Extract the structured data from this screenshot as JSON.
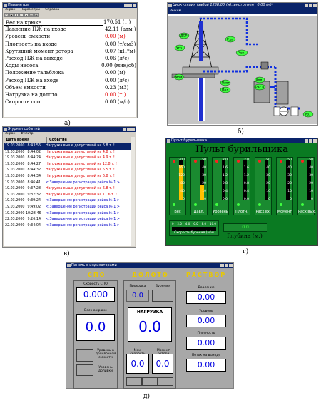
{
  "window_a": {
    "title": "Параметры",
    "menu": [
      "Экран",
      "Параметры",
      "Справка"
    ],
    "toolbar": [
      "▢",
      "▣",
      "A",
      "C",
      "S",
      "▤",
      "▦"
    ],
    "rows": [
      {
        "name": "Вес на крюке",
        "value": "170.51 (т.)",
        "red": false
      },
      {
        "name": "Давление ПЖ на входе",
        "value": "42.11 (атм.)",
        "red": false
      },
      {
        "name": "Уровень емкости",
        "value": "0.00 (м)",
        "red": true
      },
      {
        "name": "Плотность на входе",
        "value": "0.00 (т/см3)",
        "red": false
      },
      {
        "name": "Крутящий момент ротора",
        "value": "0.07 (кН*м)",
        "red": false
      },
      {
        "name": "Расход ПЖ на выходе",
        "value": "0.06 (л/с)",
        "red": false
      },
      {
        "name": "Ходы насоса",
        "value": "0.00 (мин/об)",
        "red": false
      },
      {
        "name": "Положение тальблока",
        "value": "0.00 (м)",
        "red": false
      },
      {
        "name": "Расход ПЖ на входе",
        "value": "0.00 (л/с)",
        "red": false
      },
      {
        "name": "Объем емкости",
        "value": "0.23 (м3)",
        "red": false
      },
      {
        "name": "Нагрузка на долото",
        "value": "0.00 (т.)",
        "red": true
      },
      {
        "name": "Скорость спо",
        "value": "0.00 (м/с)",
        "red": false
      }
    ],
    "caption": "а)"
  },
  "window_b": {
    "title": "Циркуляция (забой 1238.00 (м), инструмент 0.00 (м))",
    "menu": [
      "Режим"
    ],
    "labels": {
      "dcp": "ДСР",
      "ugr": "Угр.",
      "rvh": "Р.вх.",
      "mom": "Мом.",
      "pvh": "Р.вх.",
      "plot_in": "Плот.",
      "hod": "Ход.",
      "poll": "Пол.",
      "rasn": "Рас.н.",
      "ur": "Ур."
    },
    "caption": "б)"
  },
  "window_v": {
    "title": "Журнал событий",
    "menu": [
      "Экран",
      "Фильтр"
    ],
    "headers": [
      "Дата время",
      "Событие"
    ],
    "rows": [
      {
        "date": "19.03.2000",
        "time": "8:43:56",
        "text": "Нагрузка выше допустимой на 6.8 т. !",
        "kind": "warn"
      },
      {
        "date": "19.03.2000",
        "time": "8:44:02",
        "text": "Нагрузка выше допустимой на 4.8 т. !",
        "kind": "warn"
      },
      {
        "date": "19.03.2000",
        "time": "8:44:24",
        "text": "Нагрузка выше допустимой на 4.9 т. !",
        "kind": "warn"
      },
      {
        "date": "19.03.2000",
        "time": "8:44:27",
        "text": "Нагрузка выше допустимой на 12.8 т. !",
        "kind": "warn"
      },
      {
        "date": "19.03.2000",
        "time": "8:44:32",
        "text": "Нагрузка выше допустимой на 5.5 т. !",
        "kind": "warn"
      },
      {
        "date": "19.03.2000",
        "time": "8:44:34",
        "text": "Нагрузка выше допустимой на 6.8 т. !",
        "kind": "warn"
      },
      {
        "date": "19.03.2000",
        "time": "8:46:41",
        "text": "< Завершение регистрации рейса № 1 >",
        "kind": "info"
      },
      {
        "date": "19.03.2000",
        "time": "9:37:28",
        "text": "Нагрузка выше допустимой на 6.8 т. !",
        "kind": "warn"
      },
      {
        "date": "19.03.2000",
        "time": "9:37:32",
        "text": "Нагрузка выше допустимой на 11.6 т. !",
        "kind": "warn"
      },
      {
        "date": "19.03.2000",
        "time": "9:39:24",
        "text": "< Завершение регистрации рейса № 1 >",
        "kind": "info"
      },
      {
        "date": "19.03.2000",
        "time": "9:49:02",
        "text": "< Завершение регистрации рейса № 1 >",
        "kind": "info"
      },
      {
        "date": "19.03.2000",
        "time": "10:28:46",
        "text": "< Завершение регистрации рейса № 1 >",
        "kind": "info"
      },
      {
        "date": "22.03.2000",
        "time": "9:26:14",
        "text": "< Завершение регистрации рейса № 1 >",
        "kind": "info"
      },
      {
        "date": "22.03.2000",
        "time": "9:34:04",
        "text": "< Завершение регистрации рейса № 1 >",
        "kind": "info"
      }
    ],
    "caption": "в)"
  },
  "window_g": {
    "title": "Пульт бурильщика",
    "heading": "Пульт бурильщика",
    "gauges": [
      {
        "label": "Вес",
        "ticks": [
          "200",
          "160",
          "120",
          "80",
          "40",
          "0"
        ],
        "fill": 0.85
      },
      {
        "label": "Давл.",
        "ticks": [
          "50",
          "40",
          "30",
          "20",
          "10",
          "0"
        ],
        "fill": 0.35
      },
      {
        "label": "Уровень",
        "ticks": [
          "2.0",
          "1.6",
          "1.2",
          "0.8",
          "0.4",
          "0.0"
        ],
        "fill": 0
      },
      {
        "label": "Плотн.",
        "ticks": [
          "2.0",
          "1.6",
          "1.2",
          "0.8",
          "0.4",
          "0.0"
        ],
        "fill": 0
      },
      {
        "label": "Расх.вх.",
        "ticks": [
          "50",
          "40",
          "30",
          "20",
          "10",
          "0"
        ],
        "fill": 0
      },
      {
        "label": "Момент",
        "ticks": [
          "50",
          "40",
          "30",
          "20",
          "10",
          "0"
        ],
        "fill": 0
      },
      {
        "label": "Расх.вых.",
        "ticks": [
          "50",
          "40",
          "30",
          "20",
          "10",
          "0"
        ],
        "fill": 0
      }
    ],
    "speed_ticks": [
      "0",
      "2.0",
      "4.0",
      "6.0",
      "8.0",
      "10.0"
    ],
    "speed_label": "Скорость бурения (м/ч)",
    "depth_value": "0.0",
    "depth_label": "Глубина (м.)",
    "caption": "г)"
  },
  "window_d": {
    "title": "Панель с индикаторами",
    "section_spo": "СПО",
    "section_doloto": "ДОЛОТО",
    "section_rastvor": "РАСТВОР",
    "spo_speed_label": "Скорость СПО",
    "spo_speed_value": "0.000",
    "hook_weight_label": "Вес на крюке",
    "hook_weight_value": "0.0",
    "level_label": "Уровень в доливочной емкости",
    "level_dolivy_label": "Уровень доливки",
    "proxodka_label": "Проходка",
    "proxodka_value": "0.0",
    "burenie_label": "Бурение",
    "nagruzka_label": "НАГРУЗКА",
    "nagruzka_value": "0.0",
    "mex_speed_label": "Мех. скорость",
    "mex_speed_value": "0.0",
    "moment_label": "Момент ротора",
    "moment_value": "0.0",
    "davlenie_label": "Давление",
    "davlenie_value": "0.00",
    "uroven_label": "Уровень",
    "uroven_value": "0.00",
    "plotnost_label": "Плотность",
    "plotnost_value": "0.00",
    "potok_label": "Поток на выходе",
    "potok_value": "0.00",
    "caption": "д)"
  }
}
